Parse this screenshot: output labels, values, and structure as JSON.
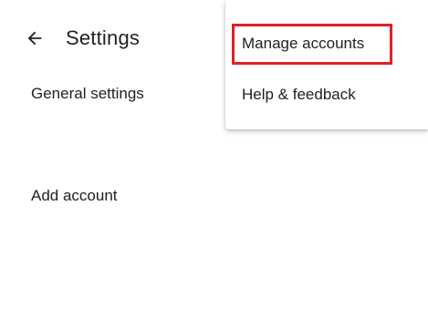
{
  "app_bar": {
    "back_icon": "arrow-back-icon",
    "title": "Settings"
  },
  "list": {
    "items": [
      {
        "label": "General settings"
      },
      {
        "label": "Add account"
      }
    ]
  },
  "overflow_menu": {
    "items": [
      {
        "label": "Manage accounts",
        "highlighted": true
      },
      {
        "label": "Help & feedback",
        "highlighted": false
      }
    ]
  },
  "colors": {
    "text": "#202124",
    "highlight": "#e0202a",
    "background": "#ffffff"
  }
}
